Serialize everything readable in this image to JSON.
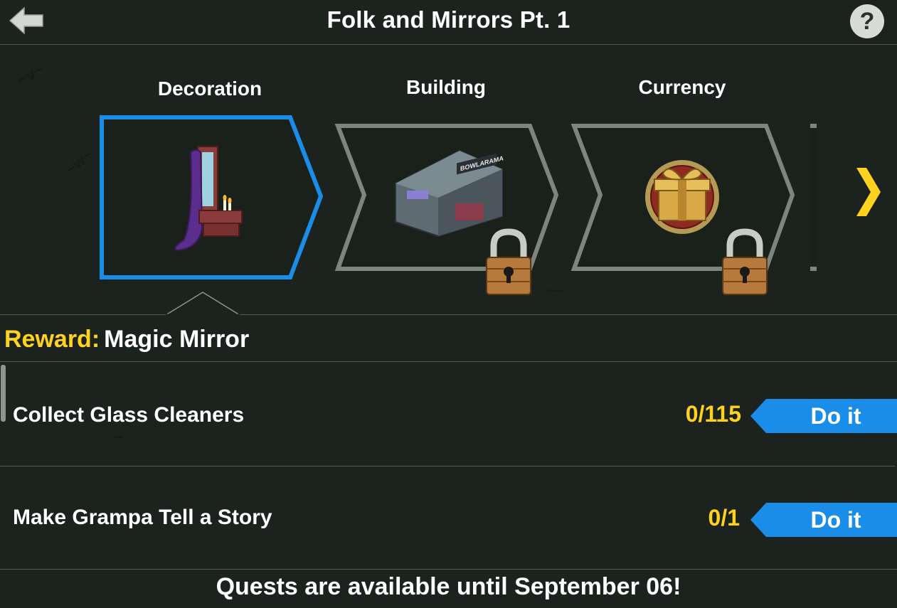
{
  "header": {
    "title": "Folk and Mirrors Pt. 1",
    "help_label": "?"
  },
  "tabs": [
    {
      "label": "Decoration",
      "selected": true,
      "locked": false,
      "icon": "magic-mirror-icon"
    },
    {
      "label": "Building",
      "selected": false,
      "locked": true,
      "icon": "bowlarama-building-icon",
      "sign_text": "BOWLARAMA"
    },
    {
      "label": "Currency",
      "selected": false,
      "locked": true,
      "icon": "gift-coin-icon"
    }
  ],
  "reward": {
    "label": "Reward:",
    "value": "Magic Mirror"
  },
  "tasks": [
    {
      "title": "Collect Glass Cleaners",
      "progress": "0/115",
      "button": "Do it"
    },
    {
      "title": "Make Grampa Tell a Story",
      "progress": "0/1",
      "button": "Do it"
    }
  ],
  "footer": {
    "text": "Quests are available until September 06!"
  },
  "colors": {
    "background": "#1c221d",
    "accent_yellow": "#ffd21f",
    "selected_border": "#1a8de8",
    "button_blue": "#1a8de8",
    "tab_border": "#7e857e"
  }
}
